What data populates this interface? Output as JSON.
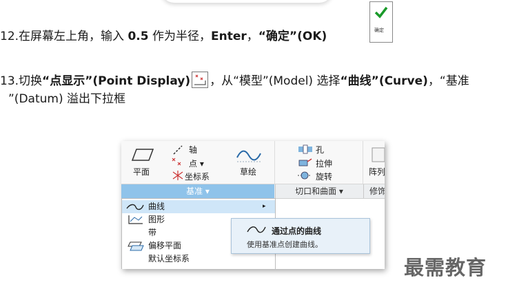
{
  "step12": {
    "prefix": "12.在屏幕左上角，输入 ",
    "value": "0.5",
    "mid": " 作为半径，",
    "enter": "Enter",
    "sep": "，",
    "ok": "“确定”(OK)"
  },
  "ok_button": {
    "label": "确定"
  },
  "step13": {
    "prefix": "13.切换",
    "point_display": "“点显示”(Point Display)",
    "mid": "，从“模型”(Model) 选择",
    "curve": "“曲线”(Curve)",
    "after": "，“基准",
    "line2": "”(Datum) 溢出下拉框"
  },
  "ribbon": {
    "plane": "平面",
    "axis": "轴",
    "point": "点 ▾",
    "csys": "坐标系",
    "sketch": "草绘",
    "hole": "孔",
    "extrude": "拉伸",
    "revolve": "旋转",
    "pattern_partial": "阵列",
    "groups": {
      "datum": "基准 ▾",
      "cut_surface": "切口和曲面 ▾",
      "modify_partial": "修饰"
    }
  },
  "menu": {
    "items": [
      {
        "label": "曲线",
        "arrow": "▸"
      },
      {
        "label": "图形"
      },
      {
        "label": "带"
      },
      {
        "label": "偏移平面"
      },
      {
        "label": "默认坐标系"
      }
    ]
  },
  "tooltip": {
    "title": "通过点的曲线",
    "desc": "使用基准点创建曲线。"
  },
  "watermark": "最需教育"
}
